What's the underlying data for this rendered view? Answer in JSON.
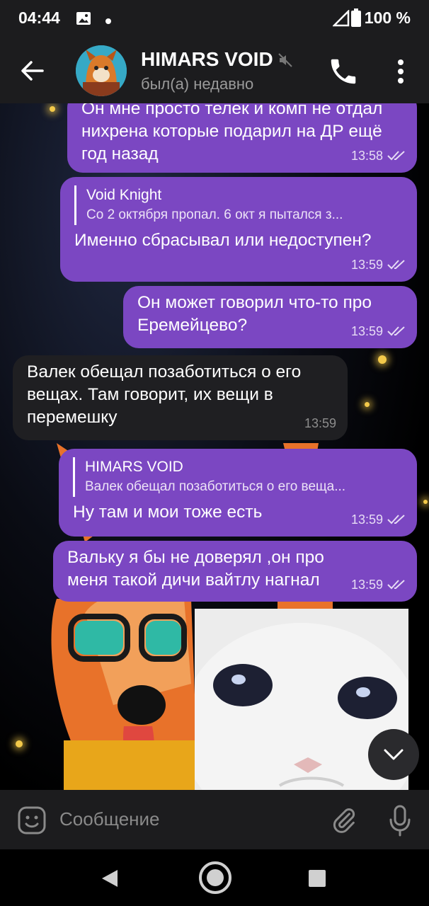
{
  "status_bar": {
    "time": "04:44",
    "battery": "100 %",
    "icons": [
      "image-notification-icon",
      "dot-icon",
      "signal-icon",
      "battery-icon"
    ]
  },
  "header": {
    "name": "HIMARS VOID",
    "status": "был(а) недавно",
    "icons": [
      "back-arrow-icon",
      "mute-icon",
      "phone-icon",
      "more-vertical-icon"
    ]
  },
  "messages": [
    {
      "direction": "out",
      "text": "Он мне просто телек и комп не отдал нихрена которые подарил на ДР ещё год назад",
      "time": "13:58",
      "read": true
    },
    {
      "direction": "out",
      "reply_name": "Void Knight",
      "reply_text": "Со 2 октября пропал. 6 окт я пытался з...",
      "text": "Именно сбрасывал или недоступен?",
      "time": "13:59",
      "read": true
    },
    {
      "direction": "out",
      "text": "Он может говорил что-то про Еремейцево?",
      "time": "13:59",
      "read": true
    },
    {
      "direction": "in",
      "text": "Валек обещал позаботиться о его вещах. Там говорит, их вещи в перемешку",
      "time": "13:59"
    },
    {
      "direction": "out",
      "reply_name": "HIMARS VOID",
      "reply_text": "Валек обещал позаботиться о его веща...",
      "text": "Ну там и мои тоже есть",
      "time": "13:59",
      "read": true
    },
    {
      "direction": "out",
      "text": "Вальку я бы не доверял ,он про меня такой дичи вайтлу нагнал",
      "time": "13:59",
      "read": true
    }
  ],
  "composer": {
    "placeholder": "Сообщение",
    "icons": [
      "emoji-icon",
      "attach-icon",
      "mic-icon"
    ]
  },
  "colors": {
    "outgoing_bubble": "#7b47c2",
    "incoming_bubble": "#1f1f22",
    "bars": "#1c1c1e"
  }
}
